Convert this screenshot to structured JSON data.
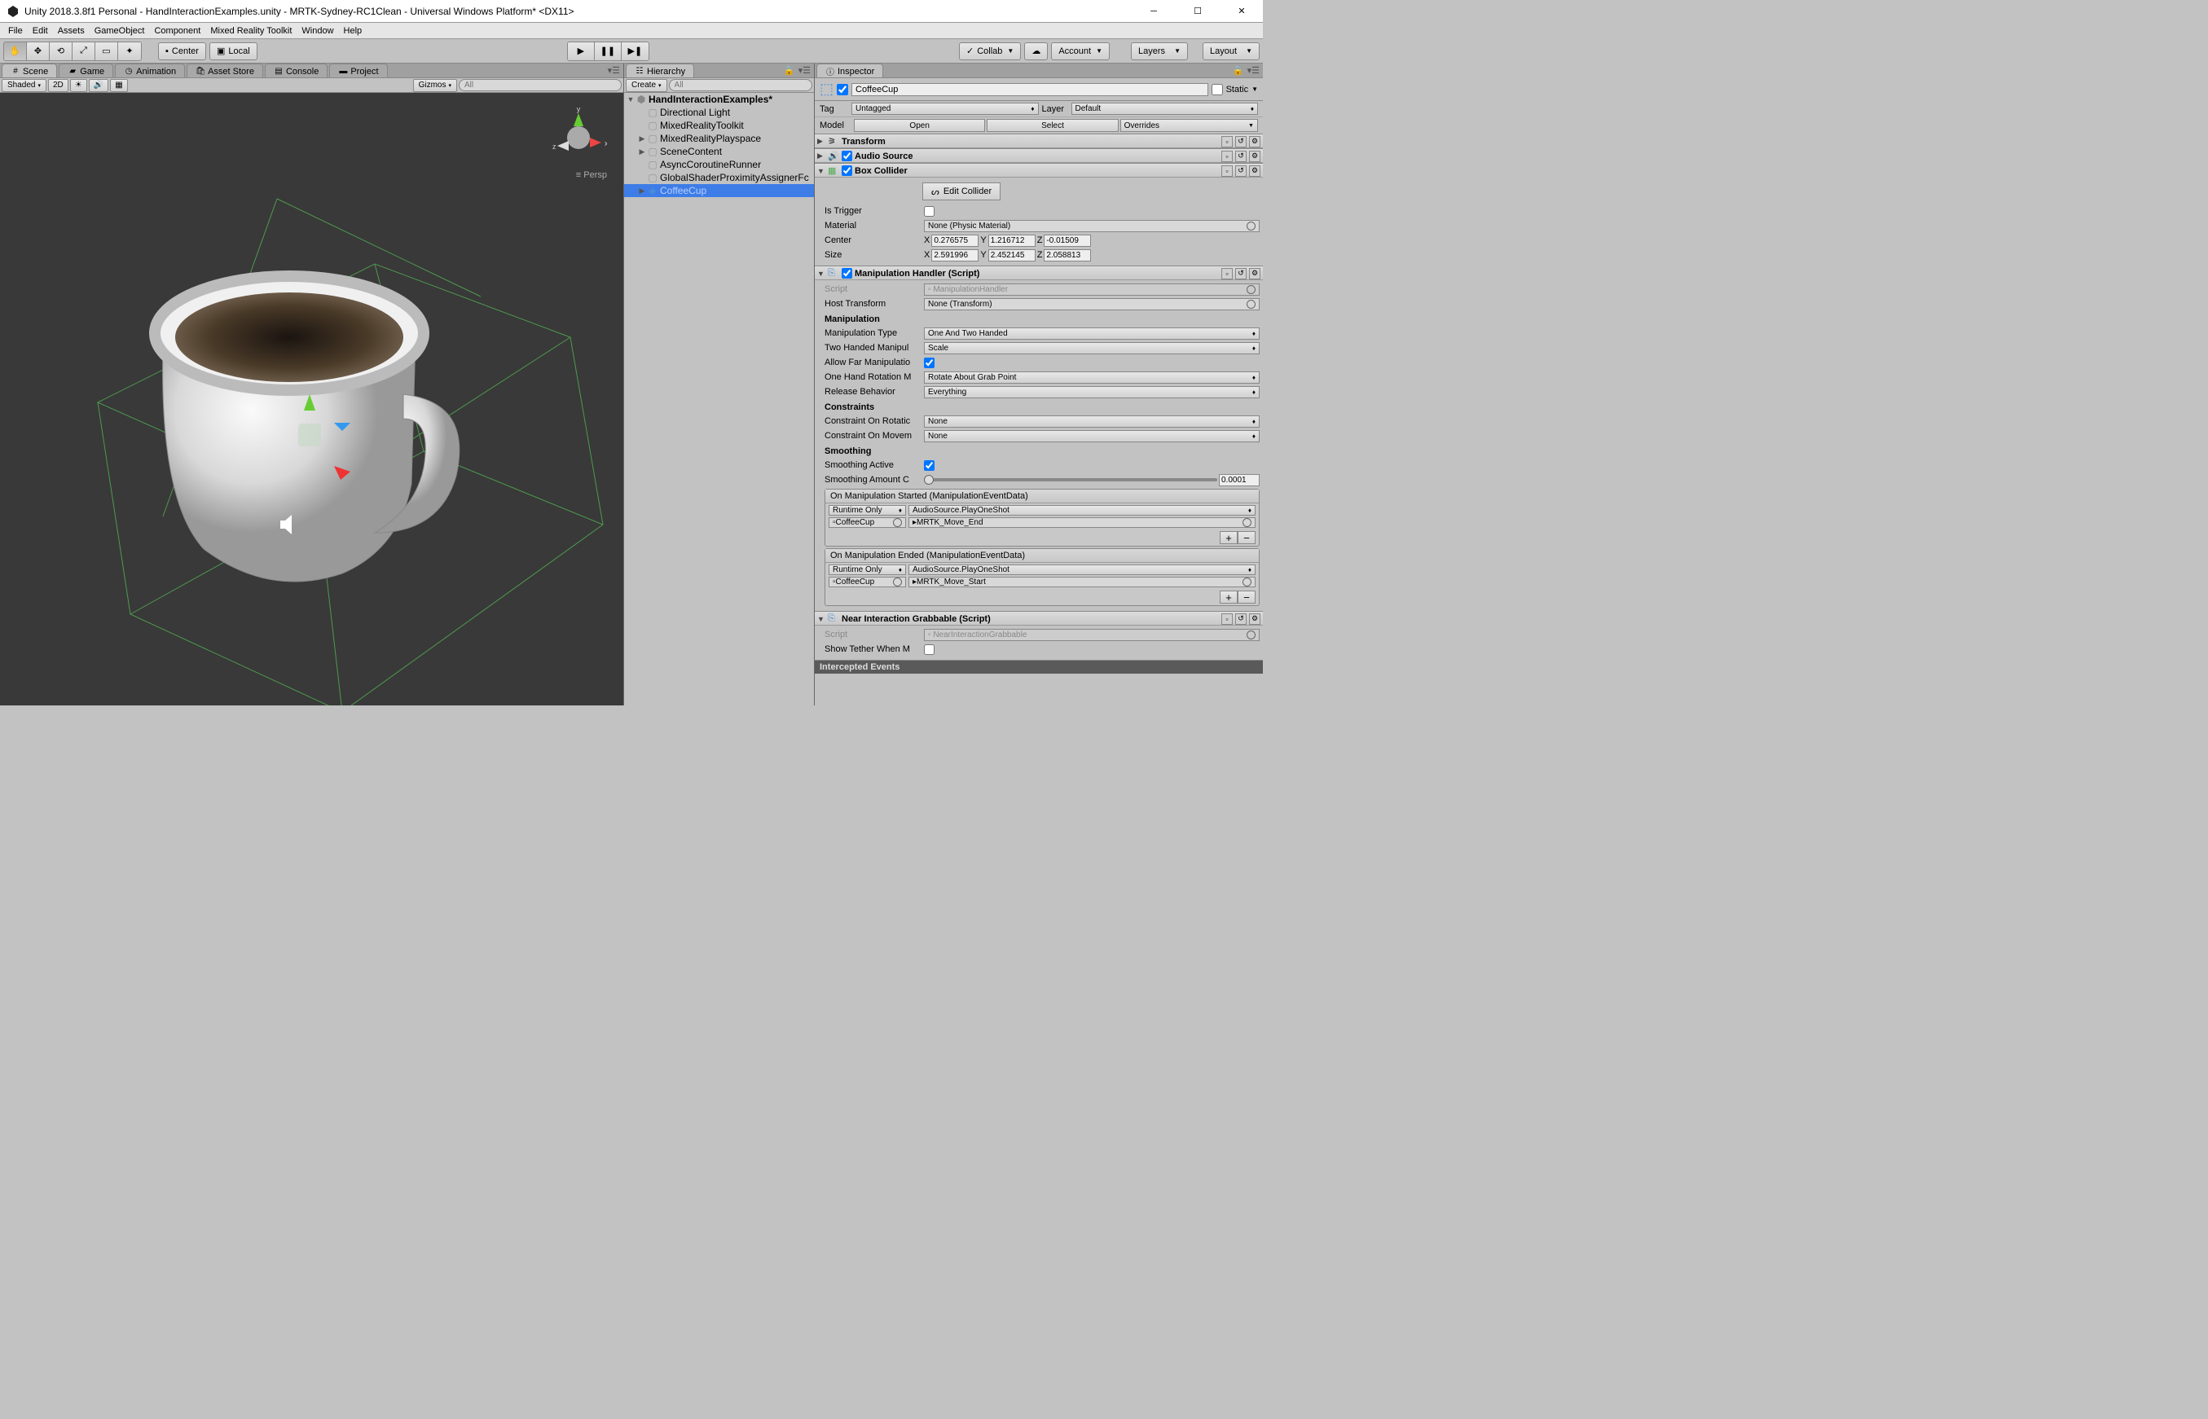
{
  "window": {
    "title": "Unity 2018.3.8f1 Personal - HandInteractionExamples.unity - MRTK-Sydney-RC1Clean - Universal Windows Platform* <DX11>"
  },
  "menu": [
    "File",
    "Edit",
    "Assets",
    "GameObject",
    "Component",
    "Mixed Reality Toolkit",
    "Window",
    "Help"
  ],
  "toolbar": {
    "pivot_local": "Local",
    "pivot_center": "Center",
    "collab": "Collab",
    "account": "Account",
    "layers": "Layers",
    "layout": "Layout"
  },
  "left_tabs": [
    "Scene",
    "Game",
    "Animation",
    "Asset Store",
    "Console",
    "Project"
  ],
  "scene_toolbar": {
    "shaded": "Shaded",
    "mode2d": "2D",
    "gizmos": "Gizmos",
    "search_placeholder": "All"
  },
  "scene": {
    "persp": "Persp",
    "axes": {
      "x": "x",
      "y": "y",
      "z": "z"
    }
  },
  "hierarchy": {
    "tab": "Hierarchy",
    "create": "Create",
    "search_placeholder": "All",
    "root": "HandInteractionExamples*",
    "items": [
      {
        "name": "Directional Light",
        "depth": 1,
        "arrow": ""
      },
      {
        "name": "MixedRealityToolkit",
        "depth": 1,
        "arrow": ""
      },
      {
        "name": "MixedRealityPlayspace",
        "depth": 1,
        "arrow": "▶"
      },
      {
        "name": "SceneContent",
        "depth": 1,
        "arrow": "▶"
      },
      {
        "name": "AsyncCoroutineRunner",
        "depth": 1,
        "arrow": ""
      },
      {
        "name": "GlobalShaderProximityAssignerFc",
        "depth": 1,
        "arrow": ""
      },
      {
        "name": "CoffeeCup",
        "depth": 1,
        "arrow": "▶",
        "selected": true,
        "prefab": true
      }
    ]
  },
  "inspector": {
    "tab": "Inspector",
    "obj_name": "CoffeeCup",
    "static_label": "Static",
    "tag_label": "Tag",
    "tag_value": "Untagged",
    "layer_label": "Layer",
    "layer_value": "Default",
    "model_label": "Model",
    "model_open": "Open",
    "model_select": "Select",
    "model_overrides": "Overrides",
    "components": {
      "transform": {
        "title": "Transform"
      },
      "audio": {
        "title": "Audio Source"
      },
      "boxcollider": {
        "title": "Box Collider",
        "edit": "Edit Collider",
        "isTrigger": "Is Trigger",
        "material": "Material",
        "material_val": "None (Physic Material)",
        "center": "Center",
        "cx": "0.276575",
        "cy": "1.216712",
        "cz": "-0.01509",
        "size": "Size",
        "sx": "2.591996",
        "sy": "2.452145",
        "sz": "2.058813"
      },
      "manip": {
        "title": "Manipulation Handler (Script)",
        "script": "Script",
        "script_val": "ManipulationHandler",
        "host": "Host Transform",
        "host_val": "None (Transform)",
        "sec1": "Manipulation",
        "type": "Manipulation Type",
        "type_val": "One And Two Handed",
        "two": "Two Handed Manipul",
        "two_val": "Scale",
        "far": "Allow Far Manipulatio",
        "onehand": "One Hand Rotation M",
        "onehand_val": "Rotate About Grab Point",
        "release": "Release Behavior",
        "release_val": "Everything",
        "sec2": "Constraints",
        "crot": "Constraint On Rotatic",
        "crot_val": "None",
        "cmov": "Constraint On Movem",
        "cmov_val": "None",
        "sec3": "Smoothing",
        "s_active": "Smoothing Active",
        "s_amount": "Smoothing Amount C",
        "s_amount_val": "0.0001",
        "ev_started": "On Manipulation Started (ManipulationEventData)",
        "ev_ended": "On Manipulation Ended (ManipulationEventData)",
        "runtime": "Runtime Only",
        "coffeecup": "CoffeeCup",
        "playoneshot": "AudioSource.PlayOneShot",
        "move_end": "MRTK_Move_End",
        "move_start": "MRTK_Move_Start"
      },
      "near": {
        "title": "Near Interaction Grabbable (Script)",
        "script": "Script",
        "script_val": "NearInteractionGrabbable",
        "tether": "Show Tether When M"
      }
    },
    "intercepted": "Intercepted Events"
  }
}
